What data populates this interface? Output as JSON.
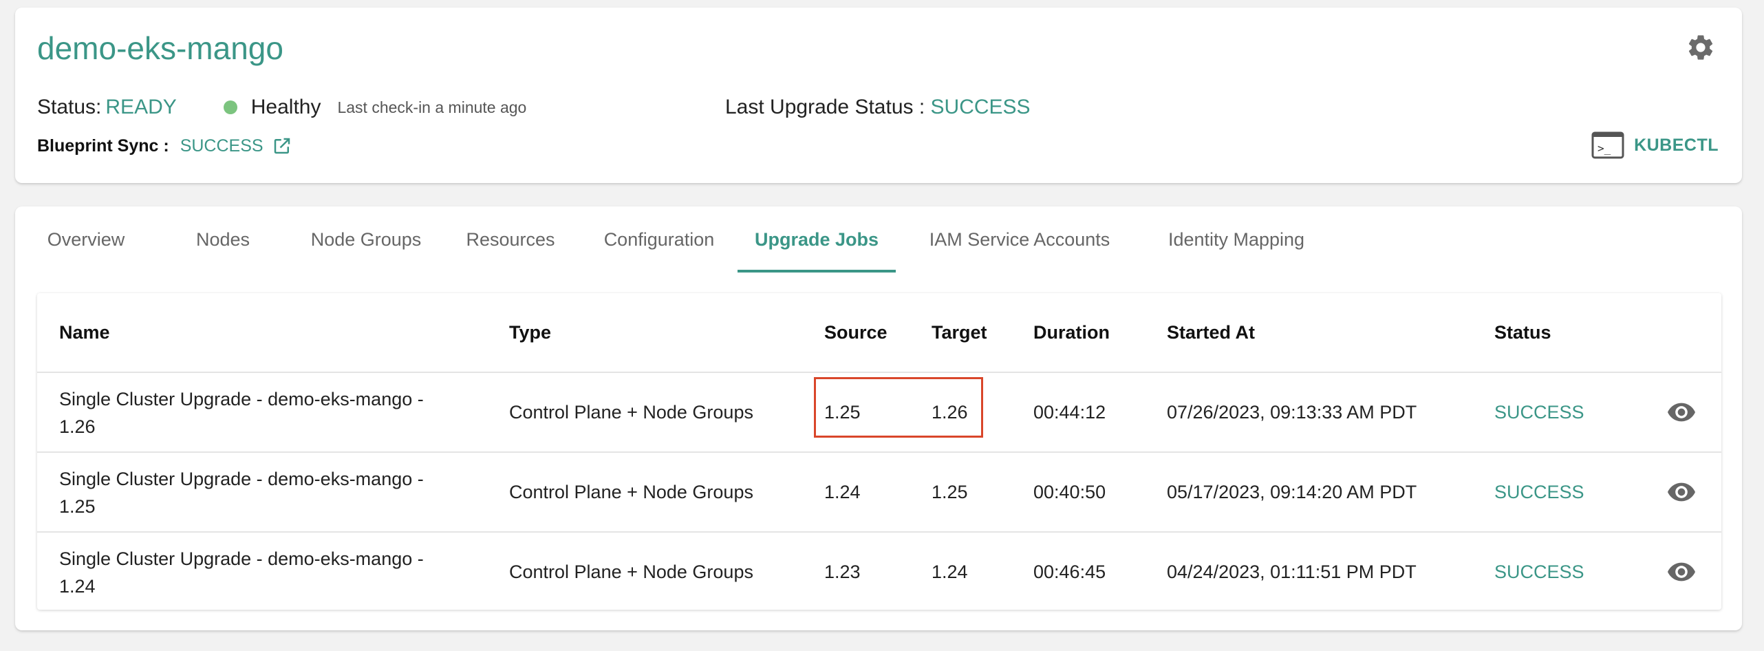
{
  "cluster": {
    "name": "demo-eks-mango",
    "status_label": "Status:",
    "status_value": "READY",
    "health": "Healthy",
    "last_checkin": "Last check-in a minute ago",
    "last_upgrade_label": "Last Upgrade Status :",
    "last_upgrade_value": "SUCCESS",
    "blueprint_label": "Blueprint Sync :",
    "blueprint_value": "SUCCESS",
    "kubectl_label": "KUBECTL"
  },
  "tabs": [
    {
      "label": "Overview"
    },
    {
      "label": "Nodes"
    },
    {
      "label": "Node Groups"
    },
    {
      "label": "Resources"
    },
    {
      "label": "Configuration"
    },
    {
      "label": "Upgrade Jobs",
      "active": true
    },
    {
      "label": "IAM Service Accounts"
    },
    {
      "label": "Identity Mapping"
    }
  ],
  "table": {
    "headers": [
      "Name",
      "Type",
      "Source",
      "Target",
      "Duration",
      "Started At",
      "Status"
    ],
    "rows": [
      {
        "name_line1": "Single Cluster Upgrade - demo-eks-mango -",
        "name_line2": "1.26",
        "type": "Control Plane + Node Groups",
        "source": "1.25",
        "target": "1.26",
        "duration": "00:44:12",
        "started_at": "07/26/2023, 09:13:33 AM PDT",
        "status": "SUCCESS"
      },
      {
        "name_line1": "Single Cluster Upgrade - demo-eks-mango -",
        "name_line2": "1.25",
        "type": "Control Plane + Node Groups",
        "source": "1.24",
        "target": "1.25",
        "duration": "00:40:50",
        "started_at": "05/17/2023, 09:14:20 AM PDT",
        "status": "SUCCESS"
      },
      {
        "name_line1": "Single Cluster Upgrade - demo-eks-mango -",
        "name_line2": "1.24",
        "type": "Control Plane + Node Groups",
        "source": "1.23",
        "target": "1.24",
        "duration": "00:46:45",
        "started_at": "04/24/2023, 01:11:51 PM PDT",
        "status": "SUCCESS"
      }
    ]
  },
  "colors": {
    "accent": "#3b9687",
    "healthy": "#7cc47f",
    "highlight": "#d9462a"
  },
  "icons": [
    "gear-icon",
    "external-link-icon",
    "terminal-icon",
    "eye-icon"
  ]
}
